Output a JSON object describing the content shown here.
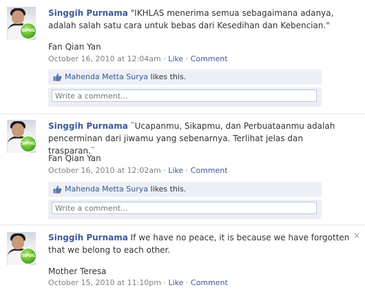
{
  "posts": [
    {
      "author": "Singgih Purnama",
      "badge_text": "SIPOG",
      "message": "\"IKHLAS menerima semua sebagaimana adanya, adalah salah satu cara untuk bebas dari Kesedihan dan Kebencian.\"",
      "source": "Fan Qian Yan",
      "timestamp": "October 16, 2010 at 12:04am",
      "like_label": "Like",
      "comment_label": "Comment",
      "liker": "Mahenda Metta Surya",
      "likes_suffix": "likes this.",
      "comment_placeholder": "Write a comment..."
    },
    {
      "author": "Singgih Purnama",
      "badge_text": "SIPOG",
      "message": "¨Ucapanmu, Sikapmu, dan Perbuataanmu adalah pencerminan dari jiwamu yang sebenarnya. Terlihat jelas dan trasparan.¨",
      "source": "Fan Qian Yan",
      "timestamp": "October 16, 2010 at 12:02am",
      "like_label": "Like",
      "comment_label": "Comment",
      "liker": "Mahenda Metta Surya",
      "likes_suffix": "likes this.",
      "comment_placeholder": "Write a comment..."
    },
    {
      "author": "Singgih Purnama",
      "badge_text": "SIPOG",
      "message": "If we have no peace, it is because we have forgotten that we belong to each other.",
      "source": "Mother Teresa",
      "timestamp": "October 15, 2010 at 11:10pm",
      "like_label": "Like",
      "comment_label": "Comment"
    }
  ],
  "close_glyph": "×",
  "separator": "·",
  "colors": {
    "link": "#3b5998",
    "likes_bg": "#eceff5",
    "meta": "#808080"
  }
}
